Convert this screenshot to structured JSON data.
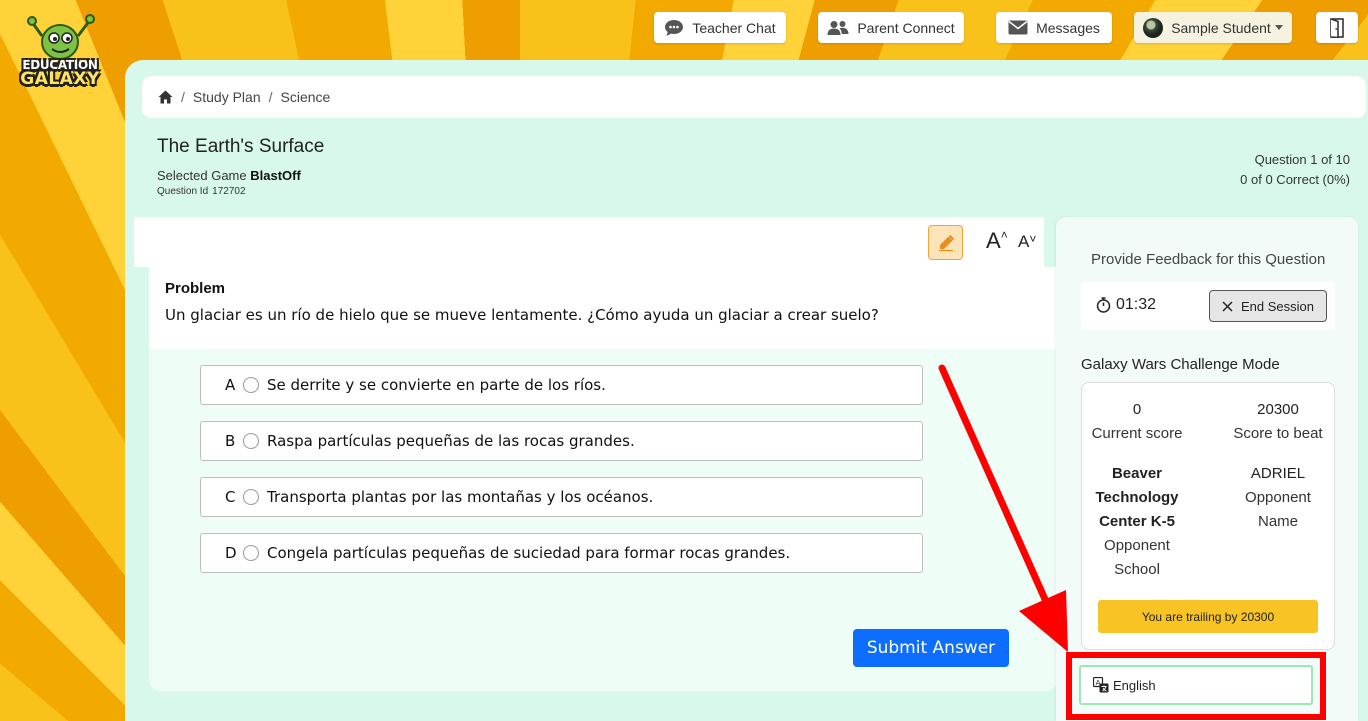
{
  "brand": {
    "logo_line1": "EDUCATION",
    "logo_line2": "GALAXY"
  },
  "topnav": {
    "teacher_chat": "Teacher Chat",
    "parent_connect": "Parent Connect",
    "messages": "Messages",
    "student_name": "Sample Student"
  },
  "breadcrumb": {
    "items": [
      "Study Plan",
      "Science"
    ]
  },
  "page": {
    "title": "The Earth's Surface",
    "selected_game_label": "Selected Game",
    "selected_game": "BlastOff",
    "question_id_label": "Question Id",
    "question_id": "172702",
    "question_progress": "Question 1 of 10",
    "correct_progress": "0 of 0 Correct (0%)"
  },
  "question": {
    "problem_label": "Problem",
    "text": "Un glaciar es un río de hielo que se mueve lentamente. ¿Cómo ayuda un glaciar a crear suelo?",
    "choices": [
      {
        "letter": "A",
        "text": "Se derrite y se convierte en parte de los ríos."
      },
      {
        "letter": "B",
        "text": "Raspa partículas pequeñas de las rocas grandes."
      },
      {
        "letter": "C",
        "text": "Transporta plantas por las montañas y los océanos."
      },
      {
        "letter": "D",
        "text": "Congela partículas pequeñas de suciedad para formar rocas grandes."
      }
    ],
    "submit_label": "Submit Answer",
    "font_up": "A",
    "font_down": "A"
  },
  "sidebar": {
    "feedback_label": "Provide Feedback for this Question",
    "timer": "01:32",
    "end_session_label": "End Session",
    "mode_title": "Galaxy Wars Challenge Mode",
    "current_score": "0",
    "current_score_label": "Current score",
    "score_to_beat": "20300",
    "score_to_beat_label": "Score to beat",
    "opponent_school_line1": "Beaver",
    "opponent_school_line2": "Technology",
    "opponent_school_line3": "Center K-5",
    "opponent_school_label1": "Opponent",
    "opponent_school_label2": "School",
    "opponent_name": "ADRIEL",
    "opponent_name_label1": "Opponent",
    "opponent_name_label2": "Name",
    "trailing_text": "You are trailing by 20300",
    "language": "English"
  },
  "colors": {
    "accent_blue": "#0d6efd",
    "panel_mint": "#d7f8ea",
    "annotation_red": "#ff0000",
    "trailing_yellow": "#f7c325"
  }
}
